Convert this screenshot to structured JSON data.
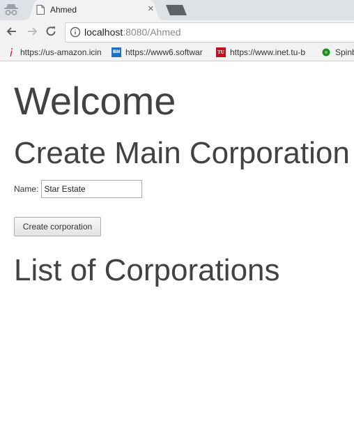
{
  "browser": {
    "tab": {
      "title": "Ahmed",
      "close_glyph": "×"
    },
    "address": {
      "host": "localhost",
      "path": ":8080/Ahmed"
    },
    "bookmarks": [
      {
        "label": "https://us-amazon.icin",
        "icon": "amazon-icon",
        "color": "#c2185b"
      },
      {
        "label": "https://www6.softwar",
        "icon": "ibm-icon",
        "color": "#1f70c1"
      },
      {
        "label": "https://www.inet.tu-b",
        "icon": "tu-berlin-icon",
        "color": "#c50e1f"
      },
      {
        "label": "Spinb",
        "icon": "spin-icon",
        "color": "#1e8e1e"
      }
    ],
    "icons": {
      "ibm": "IBM",
      "tu": "TU"
    }
  },
  "page": {
    "heading": "Welcome",
    "create_heading": "Create Main Corporation",
    "name_label": "Name:",
    "name_value": "Star Estate",
    "create_button": "Create corporation",
    "list_heading": "List of Corporations"
  }
}
